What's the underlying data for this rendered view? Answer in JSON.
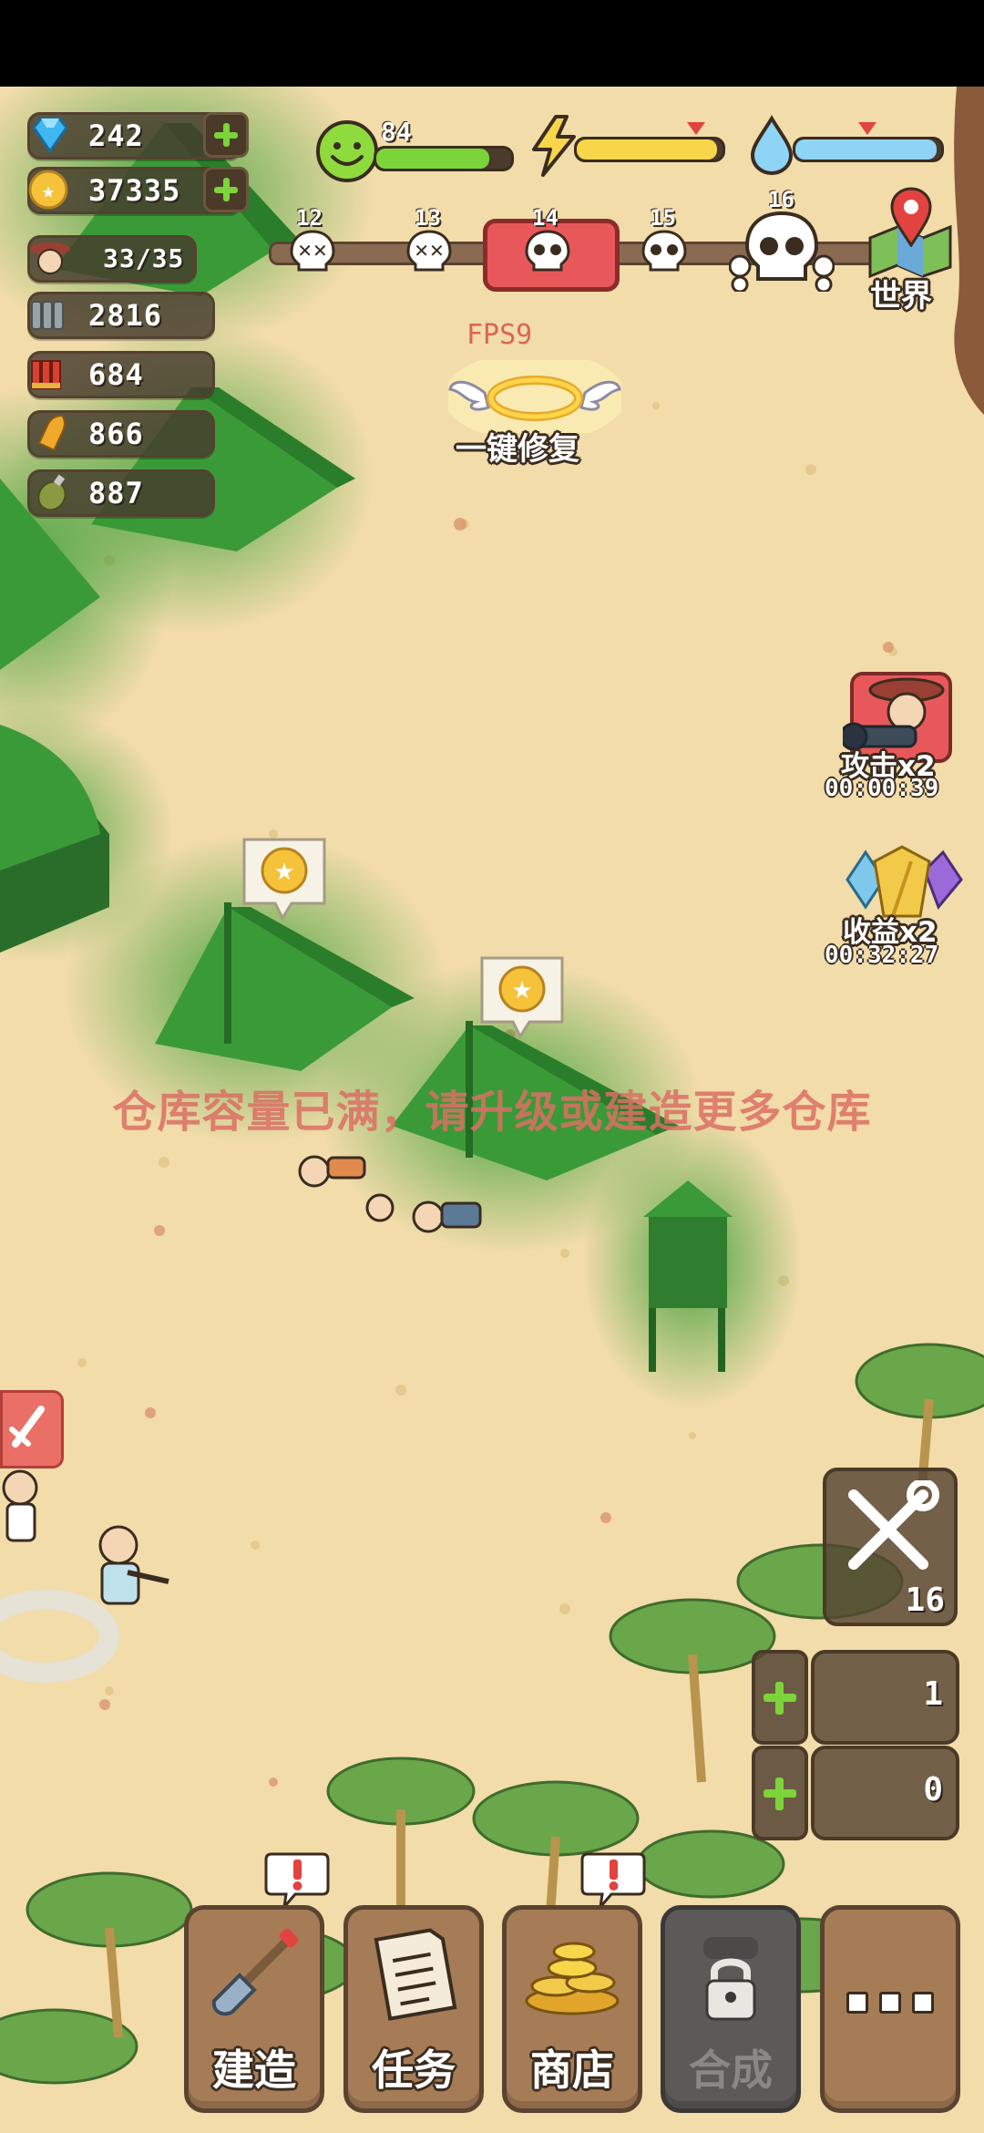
{
  "resources": {
    "gems": "242",
    "coins": "37335",
    "population": "33/35",
    "ammo_clips": "2816",
    "shotgun_shells": "684",
    "bullets": "866",
    "grenades": "887"
  },
  "status": {
    "mood_value": "84",
    "mood_fill": 0.84,
    "energy_fill": 0.96,
    "water_fill": 0.97
  },
  "waves": {
    "labels": [
      "12",
      "13",
      "14",
      "15",
      "16"
    ],
    "current": "14"
  },
  "fps_label": "FPS9",
  "world_label": "世界",
  "repair_label": "一键修复",
  "buffs": [
    {
      "label": "攻击x2",
      "timer": "00:00:39"
    },
    {
      "label": "收益x2",
      "timer": "00:32:27"
    }
  ],
  "warehouse_message": "仓库容量已满，请升级或建造更多仓库",
  "tools": {
    "repair_count": "16",
    "slot1_count": "1",
    "slot2_count": "0"
  },
  "nav": {
    "build": "建造",
    "tasks": "任务",
    "shop": "商店",
    "craft": "合成",
    "more": "..."
  },
  "colors": {
    "sand": "#f2dcaa",
    "tent_green": "#3e9a3a",
    "mood_bar": "#7cd43a",
    "energy_bar": "#f7d64a",
    "water_bar": "#8fd3f5",
    "alert_red": "#e2433f"
  }
}
